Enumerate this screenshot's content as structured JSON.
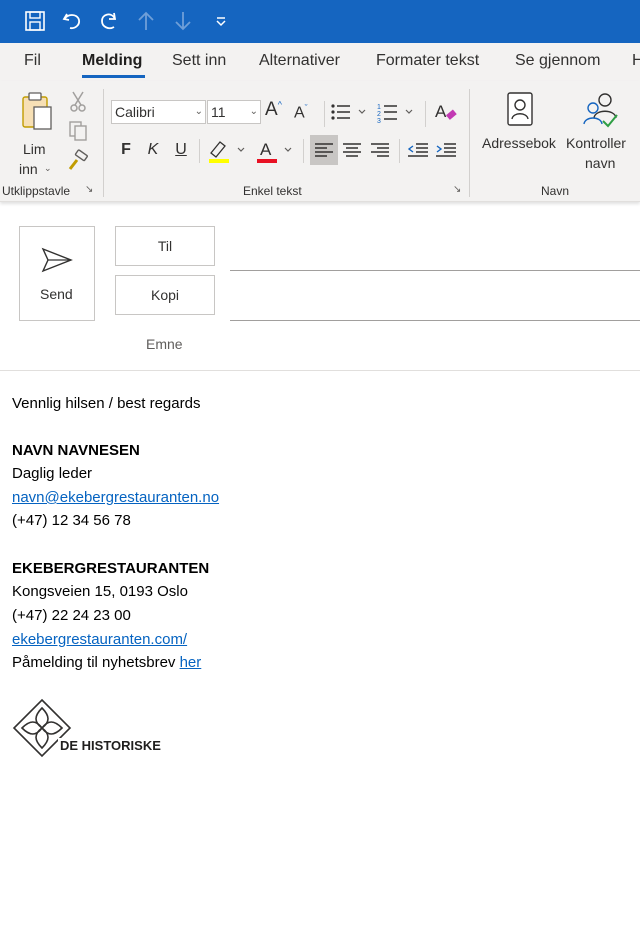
{
  "quick_access": {
    "icons": [
      "save-icon",
      "undo-icon",
      "redo-icon",
      "up-arrow-icon",
      "down-arrow-icon",
      "customize-toolbar-icon"
    ]
  },
  "tabs": [
    "Fil",
    "Melding",
    "Sett inn",
    "Alternativer",
    "Formater tekst",
    "Se gjennom",
    "H"
  ],
  "active_tab": "Melding",
  "ribbon": {
    "clipboard": {
      "paste_label_line1": "Lim",
      "paste_label_line2": "inn",
      "group_label": "Utklippstavle"
    },
    "basic_text": {
      "font_name": "Calibri",
      "font_size": "11",
      "bold": "F",
      "italic": "K",
      "underline": "U",
      "group_label": "Enkel tekst",
      "highlight_color": "#ffff00",
      "font_color": "#e81123"
    },
    "names": {
      "address_book": "Adressebok",
      "check_names_line1": "Kontroller",
      "check_names_line2": "navn",
      "group_label": "Navn"
    }
  },
  "compose": {
    "send": "Send",
    "to": "Til",
    "cc": "Kopi",
    "subject": "Emne"
  },
  "signature": {
    "greeting": "Vennlig hilsen / best regards",
    "name": "NAVN NAVNESEN",
    "title": "Daglig leder",
    "email": "navn@ekebergrestauranten.no",
    "phone": "(+47) 12 34 56 78",
    "company": "EKEBERGRESTAURANTEN",
    "address": "Kongsveien 15, 0193 Oslo",
    "company_phone": "(+47) 22 24 23 00",
    "website": "ekebergrestauranten.com/",
    "newsletter_text": "Påmelding til nyhetsbrev ",
    "newsletter_link": "her",
    "logo_text": "DE HISTORISKE"
  },
  "colors": {
    "titlebar": "#1565c0",
    "link": "#0563c1"
  }
}
